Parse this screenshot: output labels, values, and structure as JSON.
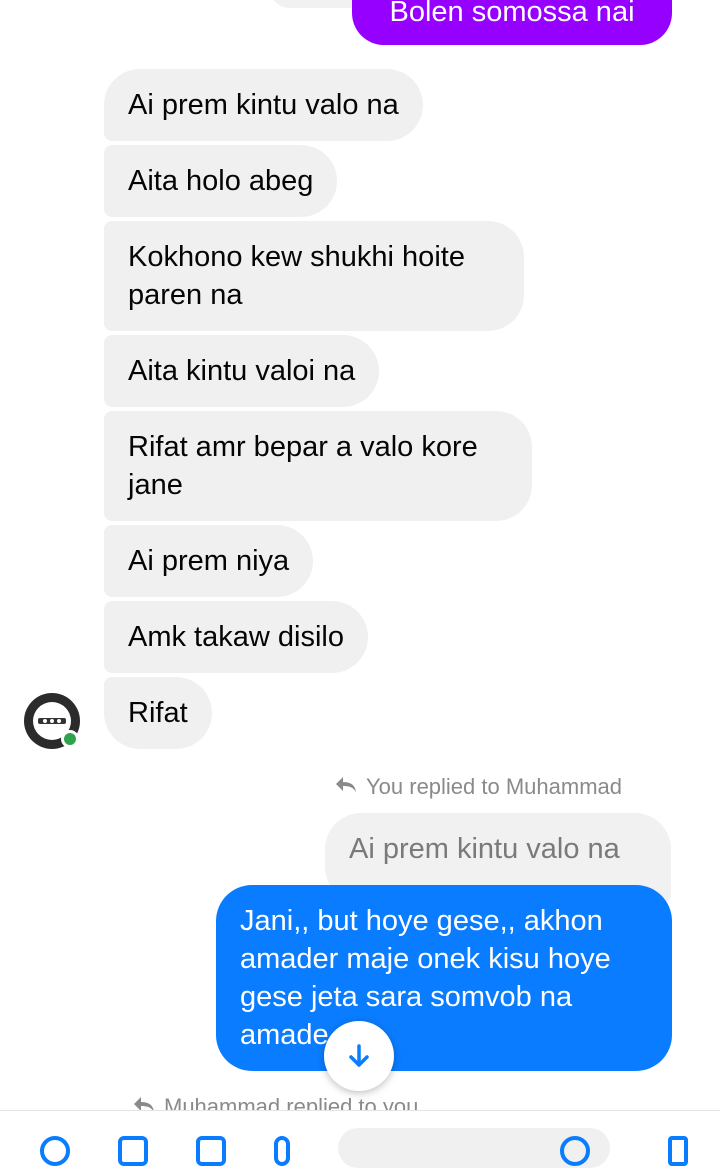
{
  "colors": {
    "sent_purple": "#9600ff",
    "sent_blue": "#0a7cff",
    "received_bg": "#f0f0f0",
    "online_green": "#31a24c"
  },
  "messages": [
    {
      "direction": "sent",
      "text": "Bolen somossa nai"
    },
    {
      "direction": "received",
      "text": "Ai prem kintu valo na"
    },
    {
      "direction": "received",
      "text": "Aita holo abeg"
    },
    {
      "direction": "received",
      "text": "Kokhono kew shukhi hoite paren na"
    },
    {
      "direction": "received",
      "text": "Aita kintu valoi na"
    },
    {
      "direction": "received",
      "text": "Rifat amr bepar a valo kore jane"
    },
    {
      "direction": "received",
      "text": "Ai prem niya"
    },
    {
      "direction": "received",
      "text": "Amk takaw disilo"
    },
    {
      "direction": "received",
      "text": "Rifat"
    }
  ],
  "reply": {
    "note": "You replied to Muhammad",
    "quoted_text": "Ai prem kintu valo na",
    "text": "Jani,,  but hoye gese,,  akhon amader maje onek kisu hoye gese jeta sara somvob na amade"
  },
  "next_reply_note": "Muhammad replied to you",
  "icons": {
    "reply": "reply-arrow-icon",
    "scroll_down": "arrow-down-icon"
  }
}
